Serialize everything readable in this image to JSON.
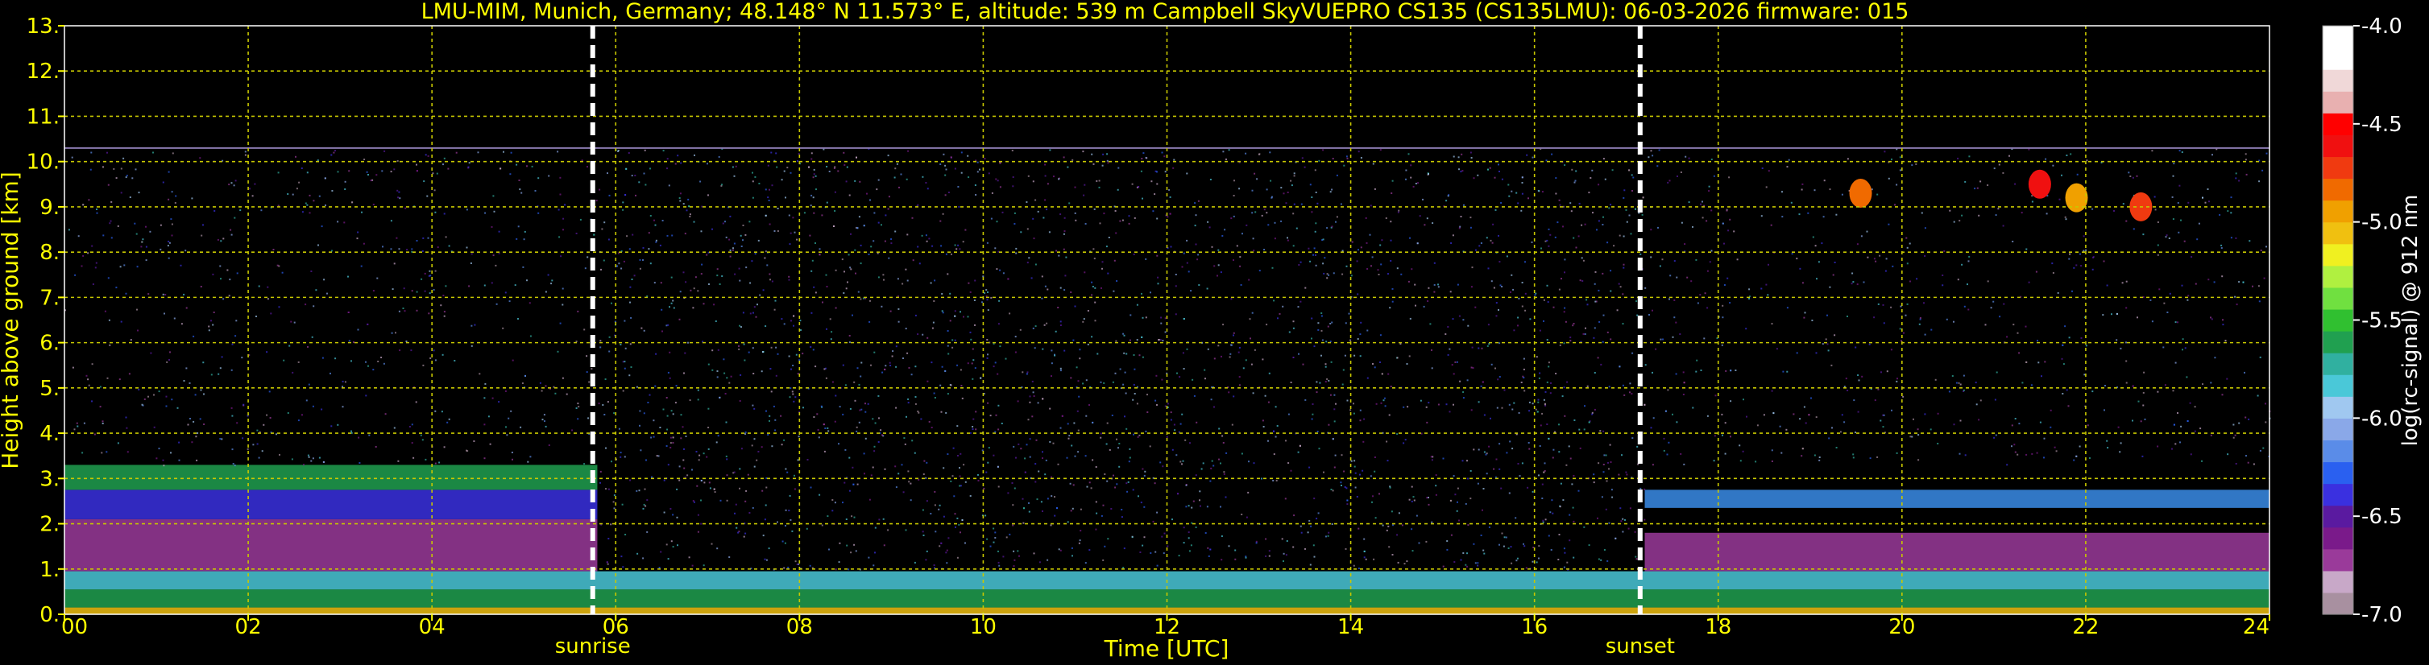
{
  "chart_data": {
    "type": "heatmap",
    "title": "LMU-MIM, Munich, Germany; 48.148° N 11.573° E, altitude: 539 m    Campbell SkyVUEPRO CS135 (CS135LMU): 06-03-2026    firmware: 015",
    "xlabel": "Time [UTC]",
    "ylabel": "Height above ground [km]",
    "xlim": [
      0,
      24
    ],
    "ylim": [
      0,
      13
    ],
    "x_ticks": [
      "00",
      "02",
      "04",
      "06",
      "08",
      "10",
      "12",
      "14",
      "16",
      "18",
      "20",
      "22",
      "24"
    ],
    "y_ticks": [
      "0.",
      "1.",
      "2.",
      "3.",
      "4.",
      "5.",
      "6.",
      "7.",
      "8.",
      "9.",
      "10.",
      "11.",
      "12.",
      "13."
    ],
    "grid": true,
    "events": [
      {
        "label": "sunrise",
        "time": 5.75
      },
      {
        "label": "sunset",
        "time": 17.15
      }
    ],
    "colorbar": {
      "label": "log(rc-signal) @ 912 nm",
      "range": [
        -7.0,
        -4.0
      ],
      "ticks": [
        "-4.0",
        "-4.5",
        "-5.0",
        "-5.5",
        "-6.0",
        "-6.5",
        "-7.0"
      ],
      "colors": [
        "#a890a0",
        "#c8a8c8",
        "#9a3a9a",
        "#7a1a8a",
        "#5a1aa0",
        "#3a30e0",
        "#2a60f0",
        "#5a8ce8",
        "#8aa8e8",
        "#a0c8f0",
        "#4ac8d8",
        "#30b0a0",
        "#20a050",
        "#30c030",
        "#70e040",
        "#b0f040",
        "#f0f020",
        "#f0c010",
        "#f0a000",
        "#f06a00",
        "#f03a10",
        "#f01010",
        "#ff0000",
        "#e8b0b0",
        "#f0d8d8",
        "#ffffff",
        "#ffffff"
      ]
    },
    "layers": [
      {
        "name": "surface high backscatter",
        "t0": 0,
        "t1": 24,
        "h0": 0.0,
        "h1": 0.15,
        "color": "#f0c010"
      },
      {
        "name": "near-surface green layer",
        "t0": 0,
        "t1": 24,
        "h0": 0.15,
        "h1": 0.55,
        "color": "#20a050"
      },
      {
        "name": "boundary layer cyan",
        "t0": 0,
        "t1": 24,
        "h0": 0.55,
        "h1": 0.95,
        "color": "#4ac8d8"
      },
      {
        "name": "night aerosol purple (morning)",
        "t0": 0,
        "t1": 5.8,
        "h0": 0.95,
        "h1": 2.1,
        "color": "#9a3a9a"
      },
      {
        "name": "residual layer blue (morning)",
        "t0": 0,
        "t1": 5.8,
        "h0": 2.1,
        "h1": 2.75,
        "color": "#3a30e0"
      },
      {
        "name": "residual layer green (morning)",
        "t0": 0,
        "t1": 5.8,
        "h0": 2.75,
        "h1": 3.3,
        "color": "#20a050"
      },
      {
        "name": "evening aerosol purple",
        "t0": 17.2,
        "t1": 24,
        "h0": 0.95,
        "h1": 1.8,
        "color": "#9a3a9a"
      },
      {
        "name": "evening blue layer",
        "t0": 17.2,
        "t1": 24,
        "h0": 2.35,
        "h1": 2.75,
        "color": "#3a8ce8"
      }
    ],
    "clouds": [
      {
        "time": 19.55,
        "height": 9.3,
        "color": "#f06a00"
      },
      {
        "time": 21.5,
        "height": 9.5,
        "color": "#f01010"
      },
      {
        "time": 21.9,
        "height": 9.2,
        "color": "#f0a000"
      },
      {
        "time": 22.6,
        "height": 9.0,
        "color": "#f03a10"
      }
    ],
    "signal_top_km": 10.3
  }
}
